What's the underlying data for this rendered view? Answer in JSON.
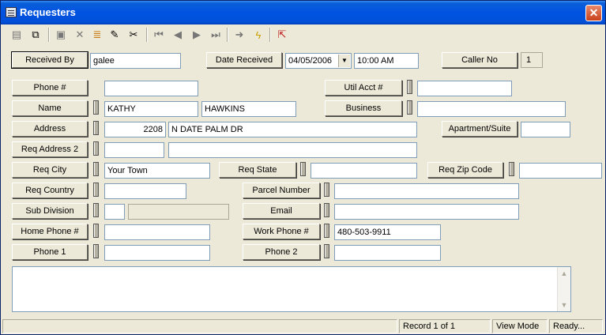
{
  "window": {
    "title": "Requesters",
    "close_label": "✕"
  },
  "toolbar": {
    "icons": [
      "new-icon",
      "copy-icon",
      "save-icon",
      "delete-icon",
      "books-icon",
      "pencil-icon",
      "scissors-icon",
      "first-record-icon",
      "prev-record-icon",
      "next-record-icon",
      "last-record-icon",
      "goto-icon",
      "lightning-icon",
      "exit-icon"
    ]
  },
  "form": {
    "received_by": {
      "label": "Received By",
      "value": "galee"
    },
    "date_received": {
      "label": "Date Received",
      "date": "04/05/2006",
      "time": "10:00 AM"
    },
    "caller_no": {
      "label": "Caller No",
      "value": "1"
    },
    "phone": {
      "label": "Phone #",
      "value": ""
    },
    "util_acct": {
      "label": "Util Acct #",
      "value": ""
    },
    "name": {
      "label": "Name",
      "first": "KATHY",
      "last": "HAWKINS"
    },
    "business": {
      "label": "Business",
      "value": ""
    },
    "address": {
      "label": "Address",
      "number": "2208",
      "street": "N DATE PALM DR"
    },
    "apartment": {
      "label": "Apartment/Suite",
      "value": ""
    },
    "req_address2": {
      "label": "Req Address 2",
      "value1": "",
      "value2": ""
    },
    "req_city": {
      "label": "Req City",
      "value": "Your Town"
    },
    "req_state": {
      "label": "Req State",
      "value": ""
    },
    "req_zip": {
      "label": "Req Zip Code",
      "value": ""
    },
    "req_country": {
      "label": "Req Country",
      "value": ""
    },
    "parcel_number": {
      "label": "Parcel Number",
      "value": ""
    },
    "sub_division": {
      "label": "Sub Division",
      "value1": "",
      "value2": ""
    },
    "email": {
      "label": "Email",
      "value": ""
    },
    "home_phone": {
      "label": "Home Phone #",
      "value": ""
    },
    "work_phone": {
      "label": "Work Phone #",
      "value": "480-503-9911"
    },
    "phone1": {
      "label": "Phone 1",
      "value": ""
    },
    "phone2": {
      "label": "Phone 2",
      "value": ""
    },
    "notes": ""
  },
  "status": {
    "record": "Record 1 of 1",
    "mode": "View Mode",
    "state": "Ready..."
  },
  "colors": {
    "titlebar": "#0053e1",
    "close": "#c8401c",
    "face": "#ece9d8"
  }
}
